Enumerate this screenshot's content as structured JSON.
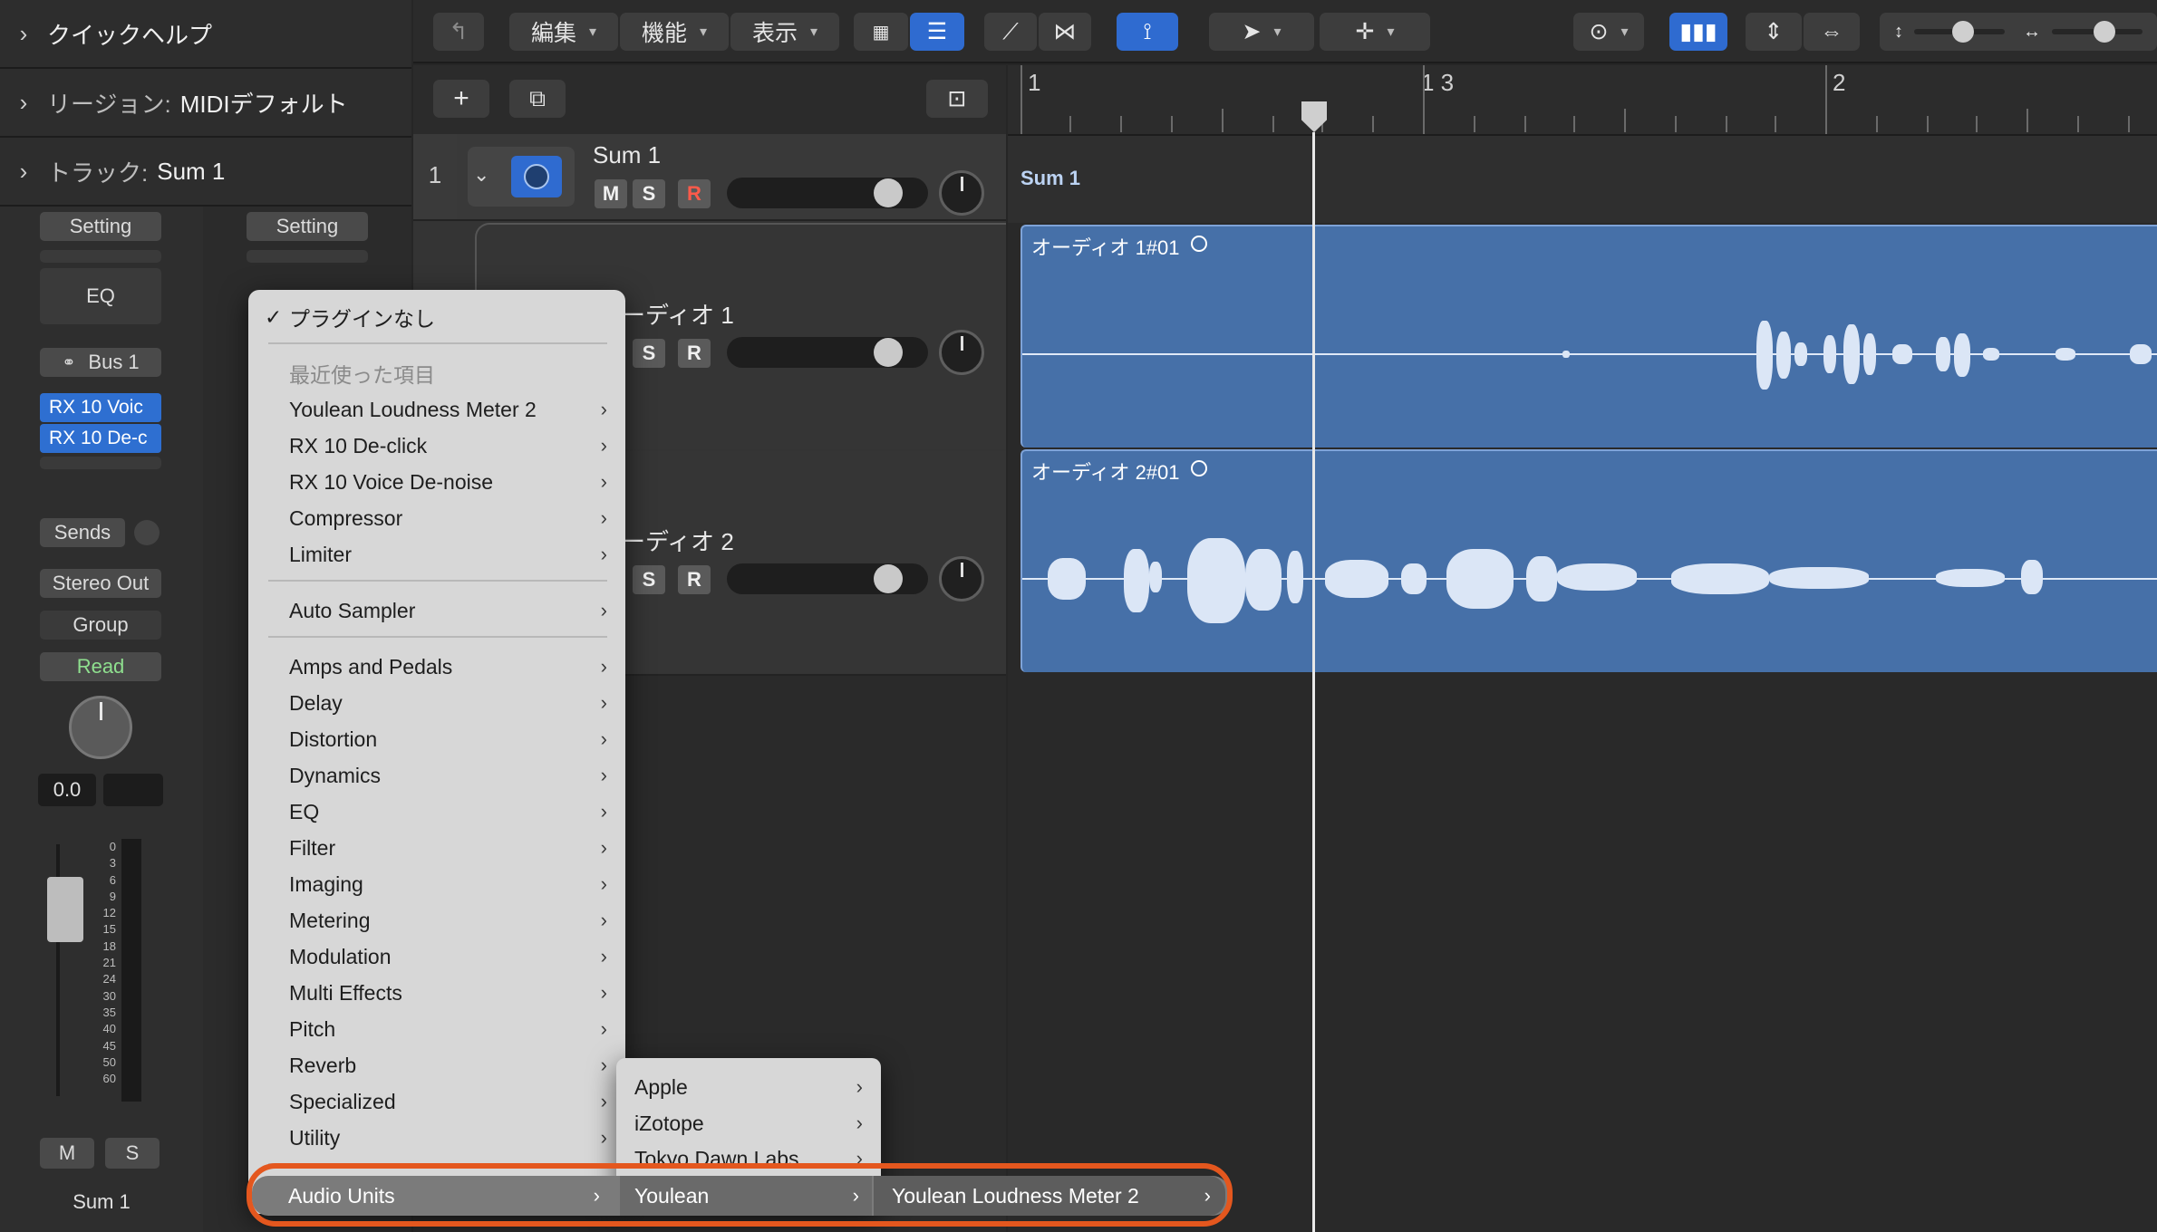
{
  "inspector": {
    "quick_help": "クイックヘルプ",
    "region_label": "リージョン:",
    "region_value": "MIDIデフォルト",
    "track_label": "トラック:",
    "track_value": "Sum 1",
    "left_strip": {
      "setting": "Setting",
      "eq": "EQ",
      "bus": "Bus 1",
      "plugins": [
        "RX 10 Voic",
        "RX 10 De-c"
      ],
      "sends": "Sends",
      "output": "Stereo Out",
      "group": "Group",
      "automation": "Read",
      "pan_value": "0.0",
      "meter_scale": [
        "0",
        "3",
        "6",
        "9",
        "12",
        "15",
        "18",
        "21",
        "24",
        "30",
        "35",
        "40",
        "45",
        "50",
        "60"
      ],
      "mute": "M",
      "solo": "S",
      "name": "Sum 1"
    },
    "right_strip": {
      "setting": "Setting"
    }
  },
  "toolbar": {
    "edit": "編集",
    "functions": "機能",
    "view": "表示"
  },
  "tracks": [
    {
      "number": "1",
      "name": "Sum 1",
      "m": "M",
      "s": "S",
      "r": "R"
    },
    {
      "name_partial": "ーディオ 1",
      "s": "S",
      "r": "R"
    },
    {
      "name_partial": "ーディオ 2",
      "s": "S",
      "r": "R"
    }
  ],
  "timeline": {
    "bars": [
      "1",
      "1 3",
      "2"
    ],
    "sum_label": "Sum 1",
    "regions": [
      "オーディオ 1#01",
      "オーディオ 2#01"
    ]
  },
  "menu": {
    "no_plugin": "プラグインなし",
    "recent_header": "最近使った項目",
    "recent": [
      "Youlean Loudness Meter 2",
      "RX 10 De-click",
      "RX 10 Voice De-noise",
      "Compressor",
      "Limiter"
    ],
    "auto_sampler": "Auto Sampler",
    "categories": [
      "Amps and Pedals",
      "Delay",
      "Distortion",
      "Dynamics",
      "EQ",
      "Filter",
      "Imaging",
      "Metering",
      "Modulation",
      "Multi Effects",
      "Pitch",
      "Reverb",
      "Specialized",
      "Utility"
    ],
    "audio_units": "Audio Units"
  },
  "submenu": {
    "items": [
      "Apple",
      "iZotope",
      "Tokyo Dawn Labs"
    ],
    "selected": "Youlean"
  },
  "submenu2": {
    "selected": "Youlean Loudness Meter 2"
  },
  "colors": {
    "accent": "#2f6bd0",
    "region": "#4670a8",
    "highlight_ring": "#e4571e"
  }
}
